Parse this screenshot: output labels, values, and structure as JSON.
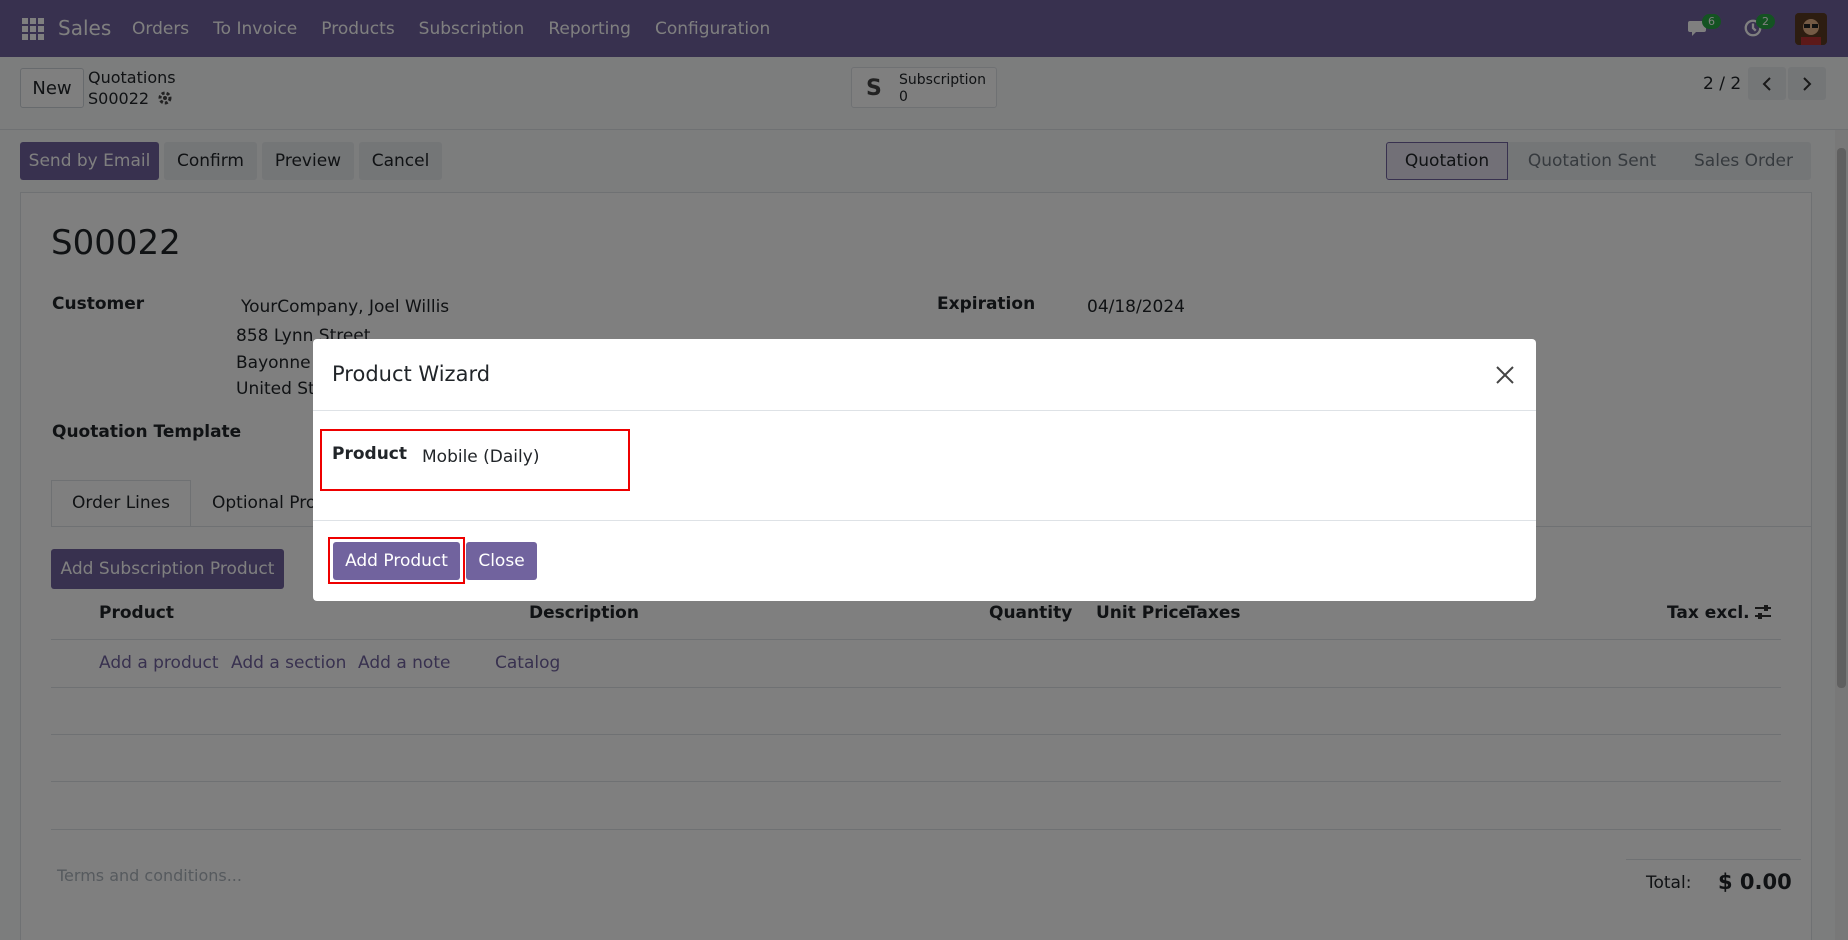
{
  "navbar": {
    "brand": "Sales",
    "menu": [
      "Orders",
      "To Invoice",
      "Products",
      "Subscription",
      "Reporting",
      "Configuration"
    ],
    "messages_badge": "6",
    "activities_badge": "2"
  },
  "control": {
    "new_label": "New",
    "breadcrumb": "Quotations",
    "record": "S00022",
    "smart_button": {
      "label": "Subscription",
      "value": "0"
    },
    "pager": "2 / 2"
  },
  "statusbar": {
    "buttons": [
      "Send by Email",
      "Confirm",
      "Preview",
      "Cancel"
    ],
    "stages": [
      "Quotation",
      "Quotation Sent",
      "Sales Order"
    ]
  },
  "form": {
    "title": "S00022",
    "customer_label": "Customer",
    "customer_lines": [
      "YourCompany, Joel Willis",
      "858 Lynn Street",
      "Bayonne N",
      "United Sta"
    ],
    "expiration_label": "Expiration",
    "expiration_value": "04/18/2024",
    "template_label": "Quotation Template",
    "tabs": [
      "Order Lines",
      "Optional Proc"
    ],
    "add_subscription_label": "Add Subscription Product",
    "columns": [
      "Product",
      "Description",
      "Quantity",
      "Unit Price",
      "Taxes",
      "Tax excl."
    ],
    "add_links": [
      "Add a product",
      "Add a section",
      "Add a note",
      "Catalog"
    ],
    "terms_placeholder": "Terms and conditions...",
    "total_label": "Total:",
    "total_value": "$ 0.00"
  },
  "modal": {
    "title": "Product Wizard",
    "field_label": "Product",
    "field_value": "Mobile (Daily)",
    "add_button": "Add Product",
    "close_button": "Close"
  },
  "colors": {
    "primary": "#71639e",
    "highlight": "#e00000"
  }
}
